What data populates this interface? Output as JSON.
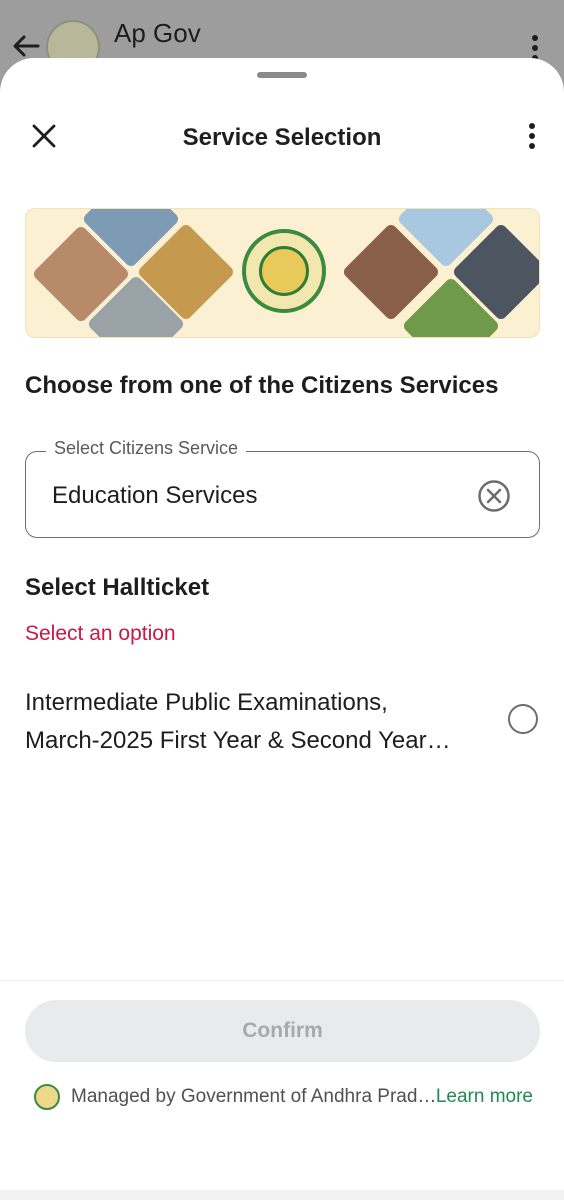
{
  "background_app": {
    "title": "Ap Gov"
  },
  "sheet": {
    "title": "Service Selection",
    "heading": "Choose from one of the Citizens Services",
    "service_field": {
      "label": "Select Citizens Service",
      "value": "Education Services"
    },
    "hallticket": {
      "heading": "Select Hallticket",
      "error": "Select an option",
      "options": [
        {
          "line1": "Intermediate Public Examinations,",
          "line2": "March-2025 First Year & Second Year…",
          "selected": false
        }
      ]
    },
    "confirm_label": "Confirm",
    "footer": {
      "managed_text": "Managed by Government of Andhra Prad…",
      "learn_more": "Learn more"
    }
  },
  "colors": {
    "error": "#c8184a",
    "link": "#1f8b4e",
    "disabled_button_bg": "#e8eaed",
    "disabled_button_text": "#a6a9ad"
  },
  "icons": [
    "back-arrow-icon",
    "more-vertical-icon",
    "close-icon",
    "clear-circle-icon",
    "radio-icon",
    "menu-icon",
    "home-square-icon",
    "back-triangle-icon"
  ]
}
